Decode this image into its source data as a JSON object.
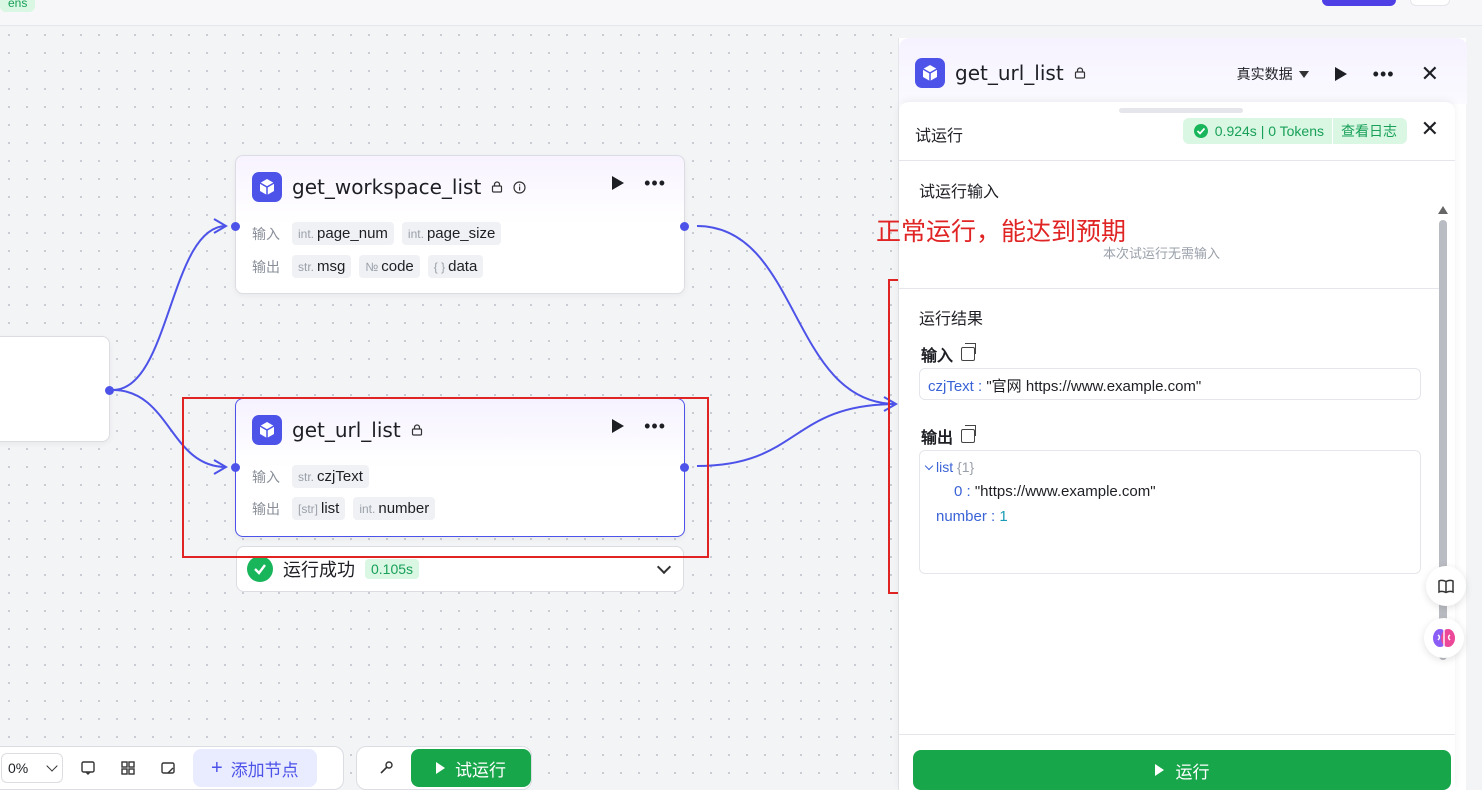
{
  "topbar": {
    "tag": "ens"
  },
  "canvas": {
    "nodes": {
      "workspace": {
        "title": "get_workspace_list",
        "input_label": "输入",
        "output_label": "输出",
        "inputs": [
          {
            "type": "int.",
            "name": "page_num"
          },
          {
            "type": "int.",
            "name": "page_size"
          }
        ],
        "outputs": [
          {
            "type": "str.",
            "name": "msg"
          },
          {
            "type": "№",
            "name": "code"
          },
          {
            "type": "{ }",
            "name": "data"
          }
        ]
      },
      "url": {
        "title": "get_url_list",
        "input_label": "输入",
        "output_label": "输出",
        "inputs": [
          {
            "type": "str.",
            "name": "czjText"
          }
        ],
        "outputs": [
          {
            "type": "[str]",
            "name": "list"
          },
          {
            "type": "int.",
            "name": "number"
          }
        ]
      }
    },
    "run_status": {
      "text": "运行成功",
      "time": "0.105s"
    },
    "annotation": "正常运行，能达到预期"
  },
  "toolbar": {
    "zoom": "0%",
    "add_node": "添加节点",
    "try_run": "试运行"
  },
  "panel": {
    "title": "get_url_list",
    "data_mode": "真实数据",
    "sheet": {
      "title": "试运行",
      "result_time": "0.924s | 0 Tokens",
      "view_log": "查看日志",
      "input_section": "试运行输入",
      "no_input": "本次试运行无需输入",
      "result_section": "运行结果",
      "input_field": "输入",
      "input_key": "czjText",
      "input_value": "\"官网 https://www.example.com\"",
      "output_field": "输出",
      "out_list_key": "list",
      "out_list_count": "{1}",
      "out_item_key": "0",
      "out_item_value": "\"https://www.example.com\"",
      "out_number_key": "number",
      "out_number_value": "1",
      "run_button": "运行"
    }
  },
  "colors": {
    "accent": "#4d53e8",
    "success": "#18a64a",
    "annotation": "#e02424"
  }
}
